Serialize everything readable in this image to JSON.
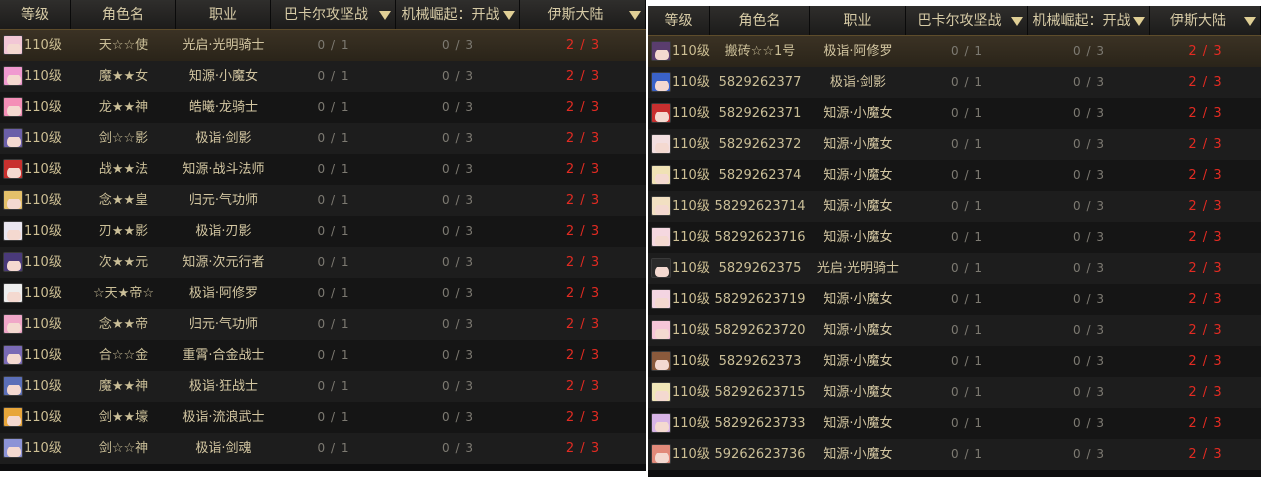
{
  "left": {
    "headers": {
      "level": "等级",
      "name": "角色名",
      "job": "职业",
      "dungeon1": "巴卡尔攻坚战",
      "dungeon2": "机械崛起：开战",
      "dungeon3": "伊斯大陆"
    },
    "rows": [
      {
        "level": "110级",
        "name": "天☆☆使",
        "job": "光启·光明骑士",
        "d1": "0 / 1",
        "d2": "0 / 3",
        "d3": "2 / 3",
        "avatar_color": "#f2c7d6"
      },
      {
        "level": "110级",
        "name": "魔★★女",
        "job": "知源·小魔女",
        "d1": "0 / 1",
        "d2": "0 / 3",
        "d3": "2 / 3",
        "avatar_color": "#f09ad0"
      },
      {
        "level": "110级",
        "name": "龙★★神",
        "job": "皓曦·龙骑士",
        "d1": "0 / 1",
        "d2": "0 / 3",
        "d3": "2 / 3",
        "avatar_color": "#f48fb7"
      },
      {
        "level": "110级",
        "name": "剑☆☆影",
        "job": "极诣·剑影",
        "d1": "0 / 1",
        "d2": "0 / 3",
        "d3": "2 / 3",
        "avatar_color": "#6b5fa8"
      },
      {
        "level": "110级",
        "name": "战★★法",
        "job": "知源·战斗法师",
        "d1": "0 / 1",
        "d2": "0 / 3",
        "d3": "2 / 3",
        "avatar_color": "#c8302e"
      },
      {
        "level": "110级",
        "name": "念★★皇",
        "job": "归元·气功师",
        "d1": "0 / 1",
        "d2": "0 / 3",
        "d3": "2 / 3",
        "avatar_color": "#e4c06a"
      },
      {
        "level": "110级",
        "name": "刃★★影",
        "job": "极诣·刃影",
        "d1": "0 / 1",
        "d2": "0 / 3",
        "d3": "2 / 3",
        "avatar_color": "#eae6f0"
      },
      {
        "level": "110级",
        "name": "次★★元",
        "job": "知源·次元行者",
        "d1": "0 / 1",
        "d2": "0 / 3",
        "d3": "2 / 3",
        "avatar_color": "#4a3a7a"
      },
      {
        "level": "110级",
        "name": "☆天★帝☆",
        "job": "极诣·阿修罗",
        "d1": "0 / 1",
        "d2": "0 / 3",
        "d3": "2 / 3",
        "avatar_color": "#eeeeee"
      },
      {
        "level": "110级",
        "name": "念★★帝",
        "job": "归元·气功师",
        "d1": "0 / 1",
        "d2": "0 / 3",
        "d3": "2 / 3",
        "avatar_color": "#f0a7c8"
      },
      {
        "level": "110级",
        "name": "合☆☆金",
        "job": "重霄·合金战士",
        "d1": "0 / 1",
        "d2": "0 / 3",
        "d3": "2 / 3",
        "avatar_color": "#7a6ab5"
      },
      {
        "level": "110级",
        "name": "魔★★神",
        "job": "极诣·狂战士",
        "d1": "0 / 1",
        "d2": "0 / 3",
        "d3": "2 / 3",
        "avatar_color": "#5b6fb8"
      },
      {
        "level": "110级",
        "name": "剑★★壕",
        "job": "极诣·流浪武士",
        "d1": "0 / 1",
        "d2": "0 / 3",
        "d3": "2 / 3",
        "avatar_color": "#e8a63a"
      },
      {
        "level": "110级",
        "name": "剑☆☆神",
        "job": "极诣·剑魂",
        "d1": "0 / 1",
        "d2": "0 / 3",
        "d3": "2 / 3",
        "avatar_color": "#8c93d6"
      }
    ]
  },
  "right": {
    "headers": {
      "level": "等级",
      "name": "角色名",
      "job": "职业",
      "dungeon1": "巴卡尔攻坚战",
      "dungeon2": "机械崛起：开战",
      "dungeon3": "伊斯大陆"
    },
    "rows": [
      {
        "level": "110级",
        "name": "搬砖☆☆1号",
        "job": "极诣·阿修罗",
        "d1": "0 / 1",
        "d2": "0 / 3",
        "d3": "2 / 3",
        "avatar_color": "#5a3d6e"
      },
      {
        "level": "110级",
        "name": "5829262377",
        "job": "极诣·剑影",
        "d1": "0 / 1",
        "d2": "0 / 3",
        "d3": "2 / 3",
        "avatar_color": "#3a62c8"
      },
      {
        "level": "110级",
        "name": "5829262371",
        "job": "知源·小魔女",
        "d1": "0 / 1",
        "d2": "0 / 3",
        "d3": "2 / 3",
        "avatar_color": "#c82f2f"
      },
      {
        "level": "110级",
        "name": "5829262372",
        "job": "知源·小魔女",
        "d1": "0 / 1",
        "d2": "0 / 3",
        "d3": "2 / 3",
        "avatar_color": "#f3dfe0"
      },
      {
        "level": "110级",
        "name": "5829262374",
        "job": "知源·小魔女",
        "d1": "0 / 1",
        "d2": "0 / 3",
        "d3": "2 / 3",
        "avatar_color": "#f0e2b5"
      },
      {
        "level": "110级",
        "name": "58292623714",
        "job": "知源·小魔女",
        "d1": "0 / 1",
        "d2": "0 / 3",
        "d3": "2 / 3",
        "avatar_color": "#f2e0c2"
      },
      {
        "level": "110级",
        "name": "58292623716",
        "job": "知源·小魔女",
        "d1": "0 / 1",
        "d2": "0 / 3",
        "d3": "2 / 3",
        "avatar_color": "#f5d8e0"
      },
      {
        "level": "110级",
        "name": "5829262375",
        "job": "光启·光明骑士",
        "d1": "0 / 1",
        "d2": "0 / 3",
        "d3": "2 / 3",
        "avatar_color": "#2a2a2a"
      },
      {
        "level": "110级",
        "name": "58292623719",
        "job": "知源·小魔女",
        "d1": "0 / 1",
        "d2": "0 / 3",
        "d3": "2 / 3",
        "avatar_color": "#f4d5e2"
      },
      {
        "level": "110级",
        "name": "58292623720",
        "job": "知源·小魔女",
        "d1": "0 / 1",
        "d2": "0 / 3",
        "d3": "2 / 3",
        "avatar_color": "#f6c6d8"
      },
      {
        "level": "110级",
        "name": "5829262373",
        "job": "知源·小魔女",
        "d1": "0 / 1",
        "d2": "0 / 3",
        "d3": "2 / 3",
        "avatar_color": "#8a5a3c"
      },
      {
        "level": "110级",
        "name": "58292623715",
        "job": "知源·小魔女",
        "d1": "0 / 1",
        "d2": "0 / 3",
        "d3": "2 / 3",
        "avatar_color": "#f1e6b8"
      },
      {
        "level": "110级",
        "name": "58292623733",
        "job": "知源·小魔女",
        "d1": "0 / 1",
        "d2": "0 / 3",
        "d3": "2 / 3",
        "avatar_color": "#d8b4e6"
      },
      {
        "level": "110级",
        "name": "59262623736",
        "job": "知源·小魔女",
        "d1": "0 / 1",
        "d2": "0 / 3",
        "d3": "2 / 3",
        "avatar_color": "#e28a7a"
      }
    ]
  }
}
